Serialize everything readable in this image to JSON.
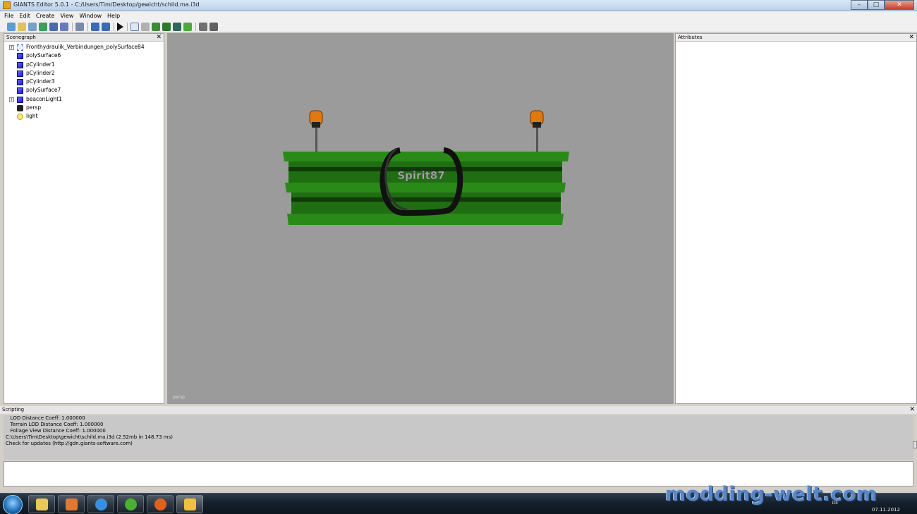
{
  "window": {
    "title": "GIANTS Editor 5.0.1 - C:/Users/Tim/Desktop/gewicht/schild.ma.i3d",
    "minimize": "–",
    "maximize": "□",
    "close": "✕"
  },
  "menu": [
    "File",
    "Edit",
    "Create",
    "View",
    "Window",
    "Help"
  ],
  "toolbar": {
    "icons": [
      "new-icon",
      "open-icon",
      "import-icon",
      "reload-icon",
      "save-icon",
      "save-as-icon",
      "export-icon",
      "undo-icon",
      "redo-icon",
      "play-icon",
      "select-icon",
      "magnet-icon",
      "terrain-sculpt-icon",
      "terrain-paint-icon",
      "terrain-smooth-icon",
      "foliage-icon",
      "navmesh-icon",
      "settings-icon"
    ]
  },
  "scenegraph": {
    "title": "Scenegraph",
    "items": [
      {
        "label": "Fronthydraulik_Verbindungen_polySurface84",
        "icon": "transform-icon",
        "expandable": true
      },
      {
        "label": "polySurface6",
        "icon": "cube-icon",
        "expandable": false
      },
      {
        "label": "pCylinder1",
        "icon": "cube-icon",
        "expandable": false
      },
      {
        "label": "pCylinder2",
        "icon": "cube-icon",
        "expandable": false
      },
      {
        "label": "pCylinder3",
        "icon": "cube-icon",
        "expandable": false
      },
      {
        "label": "polySurface7",
        "icon": "cube-icon",
        "expandable": false
      },
      {
        "label": "beaconLight1",
        "icon": "cube-icon",
        "expandable": true
      },
      {
        "label": "persp",
        "icon": "camera-icon",
        "expandable": false
      },
      {
        "label": "light",
        "icon": "light-bulb-icon",
        "expandable": false
      }
    ]
  },
  "viewport": {
    "camera_label": "persp",
    "sign_text": "Spirit87",
    "colors": {
      "background": "#9b9b9b",
      "board": "#1f6e12",
      "board_dark": "#0f3a08",
      "beacon": "#e07a10"
    }
  },
  "attributes": {
    "title": "Attributes"
  },
  "scripting": {
    "title": "Scripting",
    "lines": [
      "   LOD Distance Coeff: 1.000000",
      "   Terrain LOD Distance Coeff: 1.000000",
      "   Foliage View Distance Coeff: 1.000000",
      "C:\\Users\\Tim\\Desktop\\gewicht\\schild.ma.i3d (2.52mb in 148.73 ms)",
      "Check for updates (http://gdn.giants-software.com)"
    ]
  },
  "taskbar": {
    "apps": [
      "explorer-icon",
      "media-player-icon",
      "internet-explorer-icon",
      "icq-icon",
      "firefox-icon",
      "giants-editor-icon"
    ],
    "watermark": "modding-welt.com",
    "language": "DE",
    "date": "07.11.2012"
  }
}
